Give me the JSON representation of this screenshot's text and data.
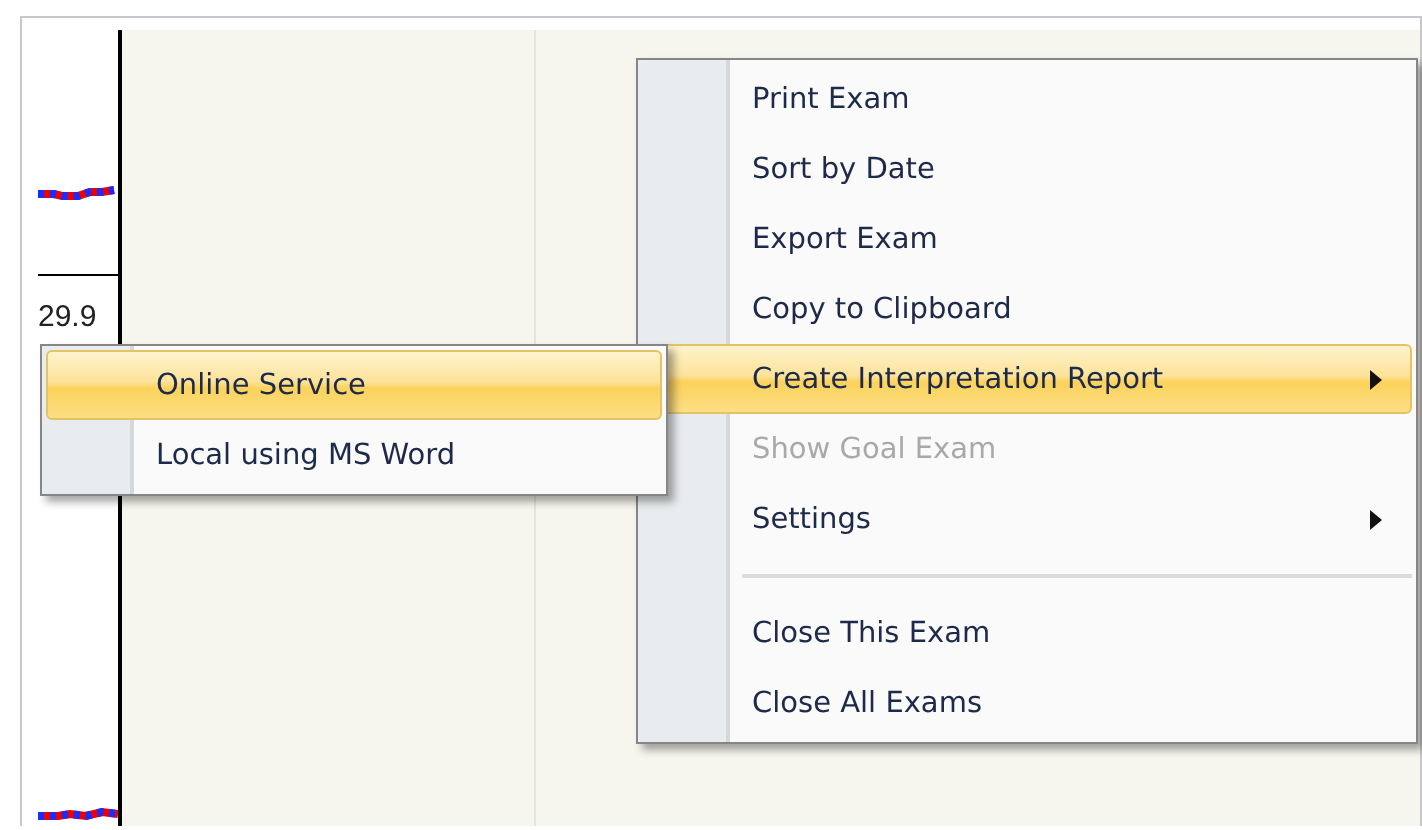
{
  "chart": {
    "axis_value": "29.9"
  },
  "menu": {
    "items": [
      {
        "kind": "item",
        "label": "Print Exam",
        "disabled": false,
        "selected": false,
        "submenu": false
      },
      {
        "kind": "item",
        "label": "Sort by Date",
        "disabled": false,
        "selected": false,
        "submenu": false
      },
      {
        "kind": "item",
        "label": "Export Exam",
        "disabled": false,
        "selected": false,
        "submenu": false
      },
      {
        "kind": "item",
        "label": "Copy to Clipboard",
        "disabled": false,
        "selected": false,
        "submenu": false
      },
      {
        "kind": "item",
        "label": "Create Interpretation Report",
        "disabled": false,
        "selected": true,
        "submenu": true
      },
      {
        "kind": "item",
        "label": "Show Goal Exam",
        "disabled": true,
        "selected": false,
        "submenu": false
      },
      {
        "kind": "item",
        "label": "Settings",
        "disabled": false,
        "selected": false,
        "submenu": true
      },
      {
        "kind": "separator"
      },
      {
        "kind": "item",
        "label": "Close This Exam",
        "disabled": false,
        "selected": false,
        "submenu": false
      },
      {
        "kind": "item",
        "label": "Close All Exams",
        "disabled": false,
        "selected": false,
        "submenu": false
      }
    ]
  },
  "submenu": {
    "items": [
      {
        "kind": "item",
        "label": "Online Service",
        "disabled": false,
        "selected": true,
        "submenu": false
      },
      {
        "kind": "item",
        "label": "Local using MS Word",
        "disabled": false,
        "selected": false,
        "submenu": false
      }
    ]
  }
}
